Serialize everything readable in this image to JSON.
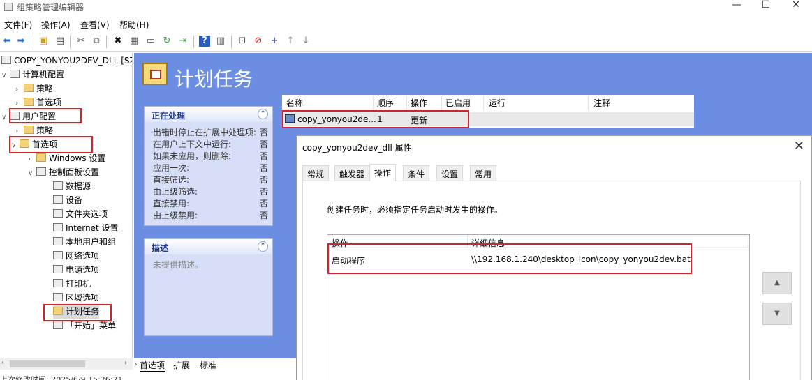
{
  "window": {
    "title": "组策略管理编辑器"
  },
  "menu": [
    "文件(F)",
    "操作(A)",
    "查看(V)",
    "帮助(H)"
  ],
  "tree": {
    "root": "COPY_YONYOU2DEV_DLL [SZ",
    "nodes": [
      {
        "label": "计算机配置",
        "depth": 0,
        "expanded": true
      },
      {
        "label": "策略",
        "depth": 1
      },
      {
        "label": "首选项",
        "depth": 1
      },
      {
        "label": "用户配置",
        "depth": 0,
        "expanded": true
      },
      {
        "label": "策略",
        "depth": 1
      },
      {
        "label": "首选项",
        "depth": 1,
        "expanded": true
      },
      {
        "label": "Windows 设置",
        "depth": 2
      },
      {
        "label": "控制面板设置",
        "depth": 2,
        "expanded": true
      },
      {
        "label": "数据源",
        "depth": 3
      },
      {
        "label": "设备",
        "depth": 3
      },
      {
        "label": "文件夹选项",
        "depth": 3
      },
      {
        "label": "Internet 设置",
        "depth": 3
      },
      {
        "label": "本地用户和组",
        "depth": 3
      },
      {
        "label": "网络选项",
        "depth": 3
      },
      {
        "label": "电源选项",
        "depth": 3
      },
      {
        "label": "打印机",
        "depth": 3
      },
      {
        "label": "区域选项",
        "depth": 3
      },
      {
        "label": "计划任务",
        "depth": 3,
        "selected": true
      },
      {
        "label": "「开始」菜单",
        "depth": 3
      }
    ]
  },
  "status_text": "上次修改时间: 2025/6/9 15:26:21",
  "main": {
    "header_title": "计划任务",
    "processing_panel": {
      "title": "正在处理",
      "rows": [
        {
          "label": "出错时停止在扩展中处理项:",
          "value": "否"
        },
        {
          "label": "在用户上下文中运行:",
          "value": "否"
        },
        {
          "label": "如果未应用，则删除:",
          "value": "否"
        },
        {
          "label": "应用一次:",
          "value": "否"
        },
        {
          "label": "直接筛选:",
          "value": "否"
        },
        {
          "label": "由上级筛选:",
          "value": "否"
        },
        {
          "label": "直接禁用:",
          "value": "否"
        },
        {
          "label": "由上级禁用:",
          "value": "否"
        }
      ]
    },
    "description_panel": {
      "title": "描述",
      "text": "未提供描述。"
    },
    "list": {
      "columns": [
        "名称",
        "顺序",
        "操作",
        "已启用",
        "运行",
        "注释"
      ],
      "rows": [
        {
          "name": "copy_yonyou2de...",
          "order": "1",
          "action": "更新"
        }
      ]
    },
    "bottom_tabs": [
      "首选项",
      "扩展",
      "标准"
    ]
  },
  "dialog": {
    "title": "copy_yonyou2dev_dll 属性",
    "tabs": [
      "常规",
      "触发器",
      "操作",
      "条件",
      "设置",
      "常用"
    ],
    "active_tab": "操作",
    "instruction": "创建任务时，必须指定任务启动时发生的操作。",
    "columns": [
      "操作",
      "详细信息"
    ],
    "rows": [
      {
        "action": "启动程序",
        "detail": "\\\\192.168.1.240\\desktop_icon\\copy_yonyou2dev.bat"
      }
    ]
  },
  "colors": {
    "accent_blue": "#6b8ee3",
    "highlight_red": "#d6222b"
  }
}
